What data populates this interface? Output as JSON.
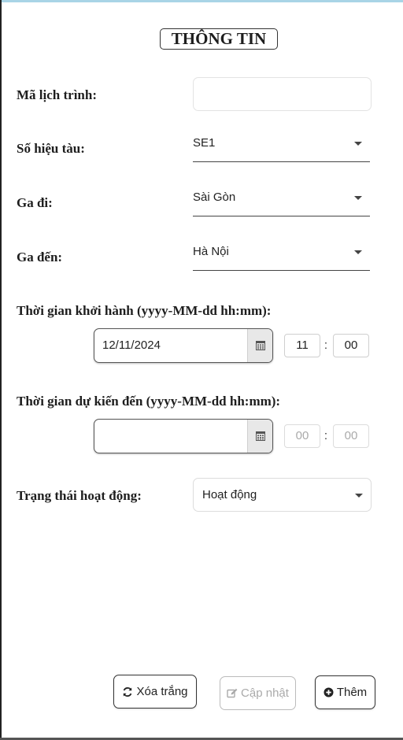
{
  "title": "THÔNG TIN",
  "fields": {
    "ma_lich_trinh": {
      "label": "Mã lịch trình:",
      "value": ""
    },
    "so_hieu_tau": {
      "label": "Số hiệu tàu:",
      "value": "SE1"
    },
    "ga_di": {
      "label": "Ga đi:",
      "value": "Sài Gòn"
    },
    "ga_den": {
      "label": "Ga đến:",
      "value": "Hà Nội"
    },
    "thoi_gian_khoi_hanh": {
      "label": "Thời gian khởi hành (yyyy-MM-dd hh:mm):",
      "date": "12/11/2024",
      "hour": "11",
      "minute": "00"
    },
    "thoi_gian_du_kien_den": {
      "label": "Thời gian dự kiến đến (yyyy-MM-dd hh:mm):",
      "date": "",
      "hour": "00",
      "minute": "00"
    },
    "trang_thai": {
      "label": "Trạng thái hoạt động:",
      "value": "Hoạt động"
    }
  },
  "time_separator": ":",
  "buttons": {
    "clear": {
      "label": "Xóa trắng",
      "icon": "refresh-icon",
      "enabled": true
    },
    "update": {
      "label": "Cập nhật",
      "icon": "edit-icon",
      "enabled": false
    },
    "add": {
      "label": "Thêm",
      "icon": "plus-circle-icon",
      "enabled": true
    }
  },
  "colors": {
    "top_strip": "#a9d4e6",
    "disabled_text": "#aaaaaa"
  }
}
